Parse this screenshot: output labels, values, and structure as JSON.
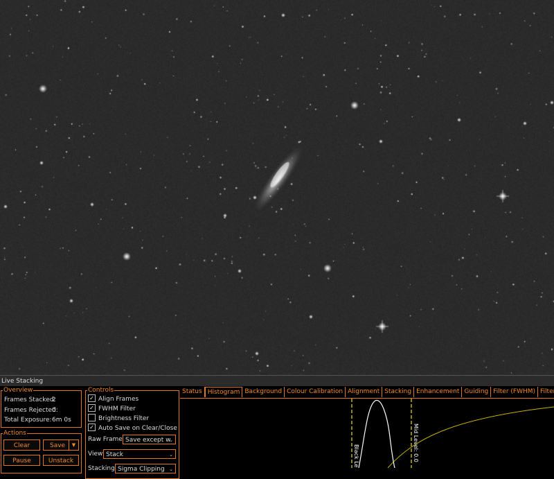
{
  "panel": {
    "title": "Live Stacking"
  },
  "overview": {
    "legend": "Overview",
    "frames_stacked_label": "Frames Stacked:",
    "frames_stacked": "2",
    "frames_rejected_label": "Frames Rejected:",
    "frames_rejected": "0",
    "total_exposure_label": "Total Exposure:",
    "total_exposure": "6m 0s"
  },
  "actions": {
    "legend": "Actions",
    "clear": "Clear",
    "save": "Save",
    "pause": "Pause",
    "unstack": "Unstack"
  },
  "controls": {
    "legend": "Controls",
    "checkboxes": [
      {
        "label": "Align Frames",
        "checked": true
      },
      {
        "label": "FWHM Filter",
        "checked": true
      },
      {
        "label": "Brightness Filter",
        "checked": false
      },
      {
        "label": "Auto Save on Clear/Close",
        "checked": true
      }
    ],
    "raw_frames_label": "Raw Frames",
    "raw_frames_value": "Save except w",
    "view_label": "View",
    "view_value": "Stack",
    "stacking_label": "Stacking",
    "stacking_value": "Sigma Clipping"
  },
  "tabs": [
    "Status",
    "Histogram",
    "Background",
    "Colour Calibration",
    "Alignment",
    "Stacking",
    "Enhancement",
    "Guiding",
    "Filter (FWHM)",
    "Filter (Brightness)"
  ],
  "active_tab": "Histogram",
  "histogram": {
    "black_level_label": "Black Le",
    "mid_level_label": "Mid Level: 0.0",
    "line_color": "#e8e000",
    "curve_color": "#ffffff",
    "stretch_color": "#c8b400"
  },
  "colors": {
    "accent": "#e07a1f",
    "background": "#000000"
  }
}
